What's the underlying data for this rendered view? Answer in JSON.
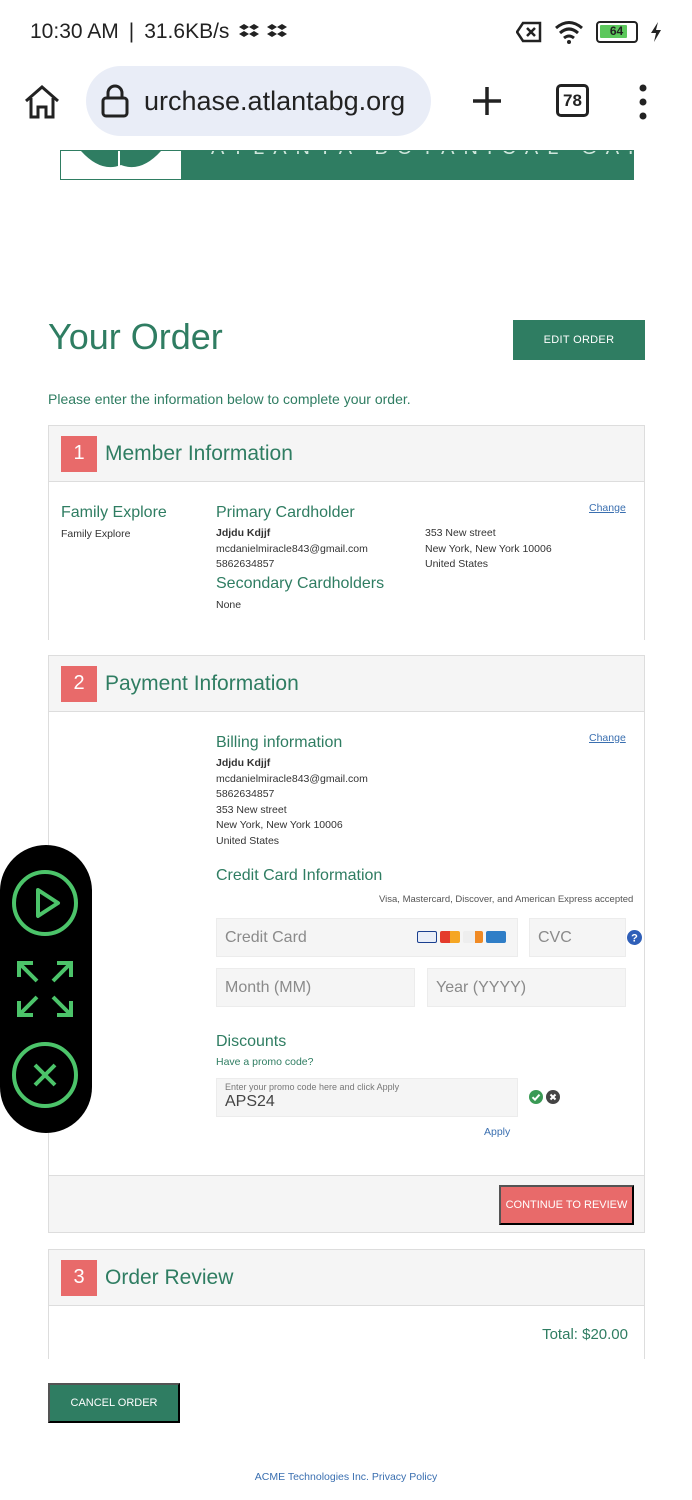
{
  "status_bar": {
    "time": "10:30 AM",
    "network_speed": "31.6KB/s",
    "battery": "64"
  },
  "browser": {
    "url": "urchase.atlantabg.org",
    "tab_count": "78"
  },
  "banner": {
    "text": "ATLANTA BOTANICAL GARDEN"
  },
  "page": {
    "title": "Your Order",
    "edit_order_label": "EDIT ORDER",
    "intro": "Please enter the information below to complete your order."
  },
  "member": {
    "step": "1",
    "title": "Member Information",
    "plan_name": "Family Explore",
    "plan_sub": "Family Explore",
    "primary_heading": "Primary Cardholder",
    "primary_name": "Jdjdu Kdjjf",
    "primary_email": "mcdanielmiracle843@gmail.com",
    "primary_phone": "5862634857",
    "address_street": "353 New street",
    "address_city": "New York, New York 10006",
    "address_country": "United States",
    "secondary_heading": "Secondary Cardholders",
    "secondary_value": "None",
    "change_label": "Change"
  },
  "payment": {
    "step": "2",
    "title": "Payment Information",
    "billing_heading": "Billing information",
    "billing_name": "Jdjdu Kdjjf",
    "billing_email": "mcdanielmiracle843@gmail.com",
    "billing_phone": "5862634857",
    "billing_street": "353 New street",
    "billing_city": "New York, New York 10006",
    "billing_country": "United States",
    "change_label": "Change",
    "cc_heading": "Credit Card Information",
    "cc_accepted": "Visa, Mastercard, Discover, and American Express accepted",
    "cc_placeholder": "Credit Card",
    "cvc_placeholder": "CVC",
    "month_placeholder": "Month (MM)",
    "year_placeholder": "Year (YYYY)",
    "discounts_heading": "Discounts",
    "promo_question": "Have a promo code?",
    "promo_hint": "Enter your promo code here and click Apply",
    "promo_value": "APS24",
    "apply_label": "Apply",
    "continue_label": "CONTINUE TO REVIEW"
  },
  "review": {
    "step": "3",
    "title": "Order Review",
    "total": "Total: $20.00"
  },
  "cancel_label": "CANCEL ORDER",
  "footer": "ACME Technologies Inc. Privacy Policy",
  "colors": {
    "brand_green": "#2f7d62",
    "accent_red": "#e86a6a",
    "link_blue": "#3a6fb0"
  }
}
